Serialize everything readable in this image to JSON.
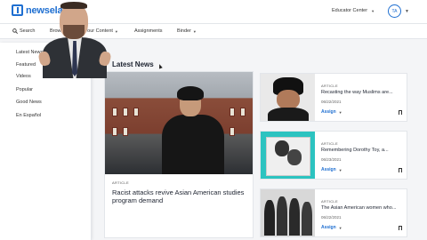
{
  "header": {
    "logo_text": "newsela",
    "educator_center": "Educator Center",
    "avatar_initials": "TA"
  },
  "nav": {
    "search": "Search",
    "browse": "Browse",
    "your_content": "Your Content",
    "assignments": "Assignments",
    "binder": "Binder"
  },
  "sidebar": {
    "items": [
      {
        "label": "Latest News"
      },
      {
        "label": "Featured"
      },
      {
        "label": "Videos"
      },
      {
        "label": "Popular"
      },
      {
        "label": "Good News"
      },
      {
        "label": "En Español"
      }
    ]
  },
  "main": {
    "section_title": "Latest News",
    "featured": {
      "label": "ARTICLE",
      "title": "Racist attacks revive Asian American studies program demand"
    },
    "cards": [
      {
        "label": "ARTICLE",
        "title": "Recasting the way Muslims are...",
        "date": "06/22/2021",
        "assign": "Assign"
      },
      {
        "label": "ARTICLE",
        "title": "Remembering Dorothy Toy, a...",
        "date": "06/23/2021",
        "assign": "Assign"
      },
      {
        "label": "ARTICLE",
        "title": "The Asian American women who...",
        "date": "06/22/2021",
        "assign": "Assign"
      }
    ]
  },
  "colors": {
    "brand": "#1f6fd1",
    "card2_bg": "#2cc3c0"
  }
}
